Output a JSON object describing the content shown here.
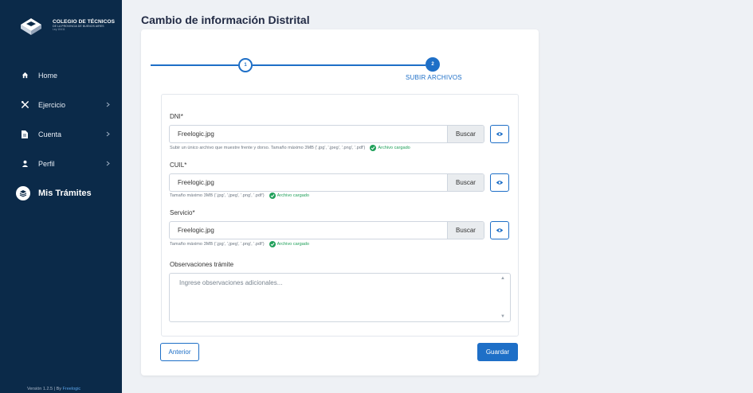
{
  "sidebar": {
    "brand": {
      "line1": "COLEGIO DE TÉCNICOS",
      "line2": "DE LA PROVINCIA DE BUENOS AIRES",
      "line3": "Ley 10411"
    },
    "items": [
      {
        "label": "Home",
        "icon": "home-icon"
      },
      {
        "label": "Ejercicio",
        "icon": "tools-icon"
      },
      {
        "label": "Cuenta",
        "icon": "document-icon"
      },
      {
        "label": "Perfil",
        "icon": "user-icon"
      },
      {
        "label": "Mis Trámites",
        "icon": "procedures-icon"
      }
    ],
    "version_text": "Versión 1.2.5 | By",
    "version_link": "Freelogic"
  },
  "page_title": "Cambio de información Distrital",
  "stepper": {
    "step1": "1",
    "step2": "2",
    "current_label": "SUBIR ARCHIVOS"
  },
  "form": {
    "dni": {
      "label": "DNI*",
      "value": "Freelogic.jpg",
      "browse": "Buscar",
      "help": "Subir un único archivo que muestre frente y dorso. Tamaño máximo 3MB ('.jpg', '.jpeg', '.png', '.pdf')",
      "status": "Archivo cargado"
    },
    "cuil": {
      "label": "CUIL*",
      "value": "Freelogic.jpg",
      "browse": "Buscar",
      "help": "Tamaño máximo 3MB ('.jpg', '.jpeg', '.png', '.pdf')",
      "status": "Archivo cargado"
    },
    "servicio": {
      "label": "Servicio*",
      "value": "Freelogic.jpg",
      "browse": "Buscar",
      "help": "Tamaño máximo 3MB ('.jpg', '.jpeg', '.png', '.pdf')",
      "status": "Archivo cargado"
    },
    "observaciones": {
      "label": "Observaciones trámite",
      "placeholder": "Ingrese observaciones adicionales..."
    }
  },
  "actions": {
    "prev": "Anterior",
    "save": "Guardar"
  },
  "colors": {
    "sidebar": "#0b2a49",
    "primary": "#1e6fc7",
    "success": "#20a05a"
  }
}
